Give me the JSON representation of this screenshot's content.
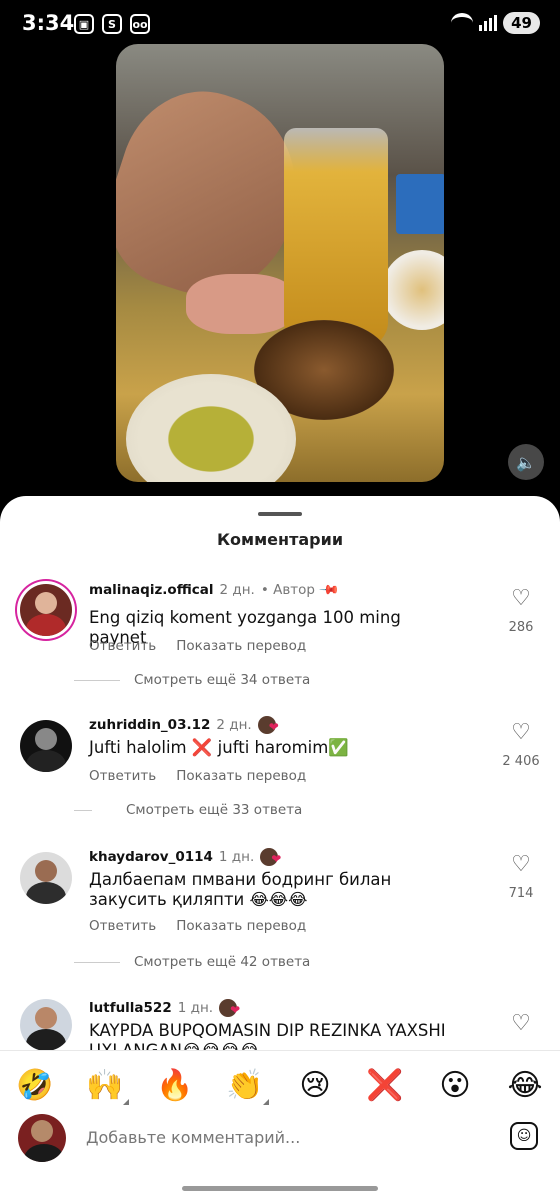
{
  "status_bar": {
    "time": "3:34",
    "battery": "49"
  },
  "sheet": {
    "title": "Комментарии"
  },
  "comments": [
    {
      "username": "malinaqiz.offical",
      "date": "2 дн.",
      "author_label": "• Автор",
      "text": "Eng qiziq koment yozganga 100 ming paynet",
      "reply_label": "Ответить",
      "translate_label": "Показать перевод",
      "likes": "286",
      "more_replies": "Смотреть ещё 34 ответа"
    },
    {
      "username": "zuhriddin_03.12",
      "date": "2 дн.",
      "text": "Jufti halolim ❌ jufti haromim✅",
      "reply_label": "Ответить",
      "translate_label": "Показать перевод",
      "likes": "2 406",
      "more_replies": "Смотреть ещё 33 ответа"
    },
    {
      "username": "khaydarov_0114",
      "date": "1 дн.",
      "text": "Далбаепам пмвани бодринг билан закусить қиляпти 😂😂😂",
      "reply_label": "Ответить",
      "translate_label": "Показать перевод",
      "likes": "714",
      "more_replies": "Смотреть ещё 42 ответа"
    },
    {
      "username": "lutfulla522",
      "date": "1 дн.",
      "text": "KAYPDA BUPQOMASIN DIP REZINKA YAXSHI UXLANGAN😂😂😂😂"
    }
  ],
  "emoji_bar": [
    "🤣",
    "🙌",
    "🔥",
    "👏",
    "😢",
    "❌",
    "😮",
    "😂"
  ],
  "compose": {
    "placeholder": "Добавьте комментарий..."
  },
  "icons": {
    "pin": "pin-icon",
    "heart": "heart-icon",
    "volume": "volume-icon",
    "sticker": "sticker-icon"
  },
  "colors": {
    "accent_ring": "#d6249f",
    "like_heart": "#e0245e"
  }
}
